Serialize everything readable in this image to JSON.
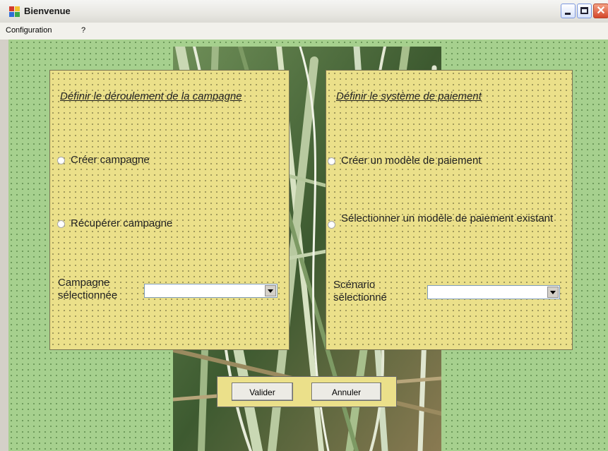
{
  "window": {
    "title": "Bienvenue"
  },
  "menu": {
    "items": [
      "Configuration",
      "?"
    ]
  },
  "campaign_panel": {
    "title": "Définir le déroulement de la campagne",
    "options": [
      "Créer campagne",
      "Récupérer campagne"
    ],
    "field_label": "Campagne sélectionnée",
    "selected_value": ""
  },
  "payment_panel": {
    "title": "Définir le système de paiement",
    "options": [
      "Créer un modèle de paiement",
      "Sélectionner un modèle de paiement existant"
    ],
    "field_label": "Scénario sélectionné",
    "selected_value": ""
  },
  "buttons": {
    "validate": "Valider",
    "cancel": "Annuler"
  },
  "colors": {
    "client_bg": "#a6d08e",
    "panel_bg": "#ebe08a",
    "close_button": "#d4462a"
  },
  "icons": [
    "app-icon",
    "minimize-icon",
    "maximize-icon",
    "close-icon",
    "radio-icon",
    "chevron-down-icon"
  ]
}
